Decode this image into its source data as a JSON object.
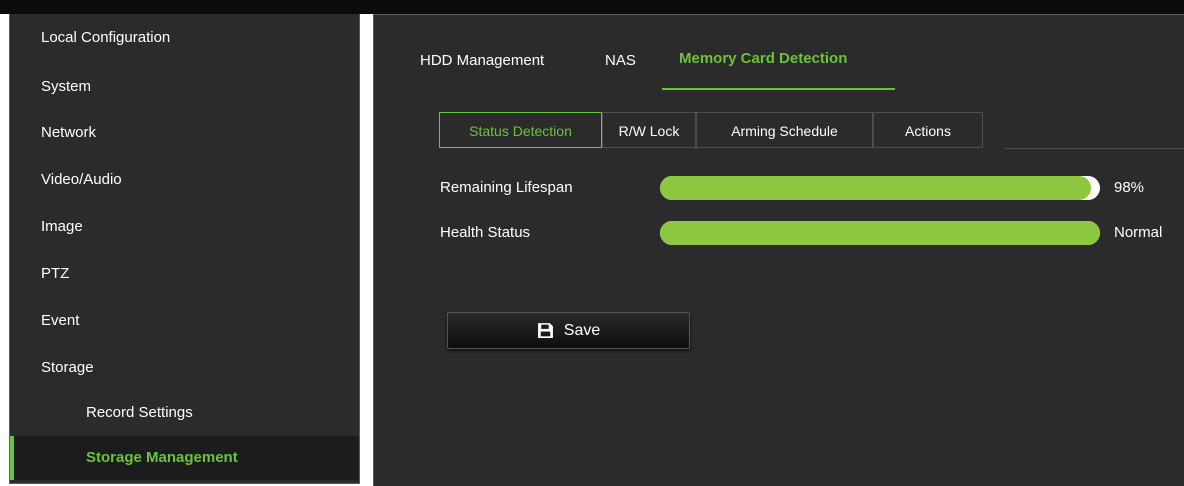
{
  "sidebar": {
    "items": [
      {
        "label": "Local Configuration"
      },
      {
        "label": "System"
      },
      {
        "label": "Network"
      },
      {
        "label": "Video/Audio"
      },
      {
        "label": "Image"
      },
      {
        "label": "PTZ"
      },
      {
        "label": "Event"
      },
      {
        "label": "Storage"
      },
      {
        "label": "Record Settings"
      },
      {
        "label": "Storage Management"
      }
    ],
    "active_item": "Storage Management"
  },
  "main": {
    "tabs": [
      {
        "label": "HDD Management"
      },
      {
        "label": "NAS"
      },
      {
        "label": "Memory Card Detection"
      }
    ],
    "active_tab": "Memory Card Detection",
    "subtabs": [
      {
        "label": "Status Detection"
      },
      {
        "label": "R/W Lock"
      },
      {
        "label": "Arming Schedule"
      },
      {
        "label": "Actions"
      }
    ],
    "active_subtab": "Status Detection",
    "rows": [
      {
        "label": "Remaining Lifespan",
        "value": "98%",
        "fill_fraction": 0.98
      },
      {
        "label": "Health Status",
        "value": "Normal",
        "fill_fraction": 1.0
      }
    ],
    "save_label": "Save"
  },
  "colors": {
    "accent": "#6ac33b",
    "bar_fill": "#8dc63f",
    "panel_bg": "#2b2b2b"
  },
  "icons": {
    "save": "save-icon"
  }
}
